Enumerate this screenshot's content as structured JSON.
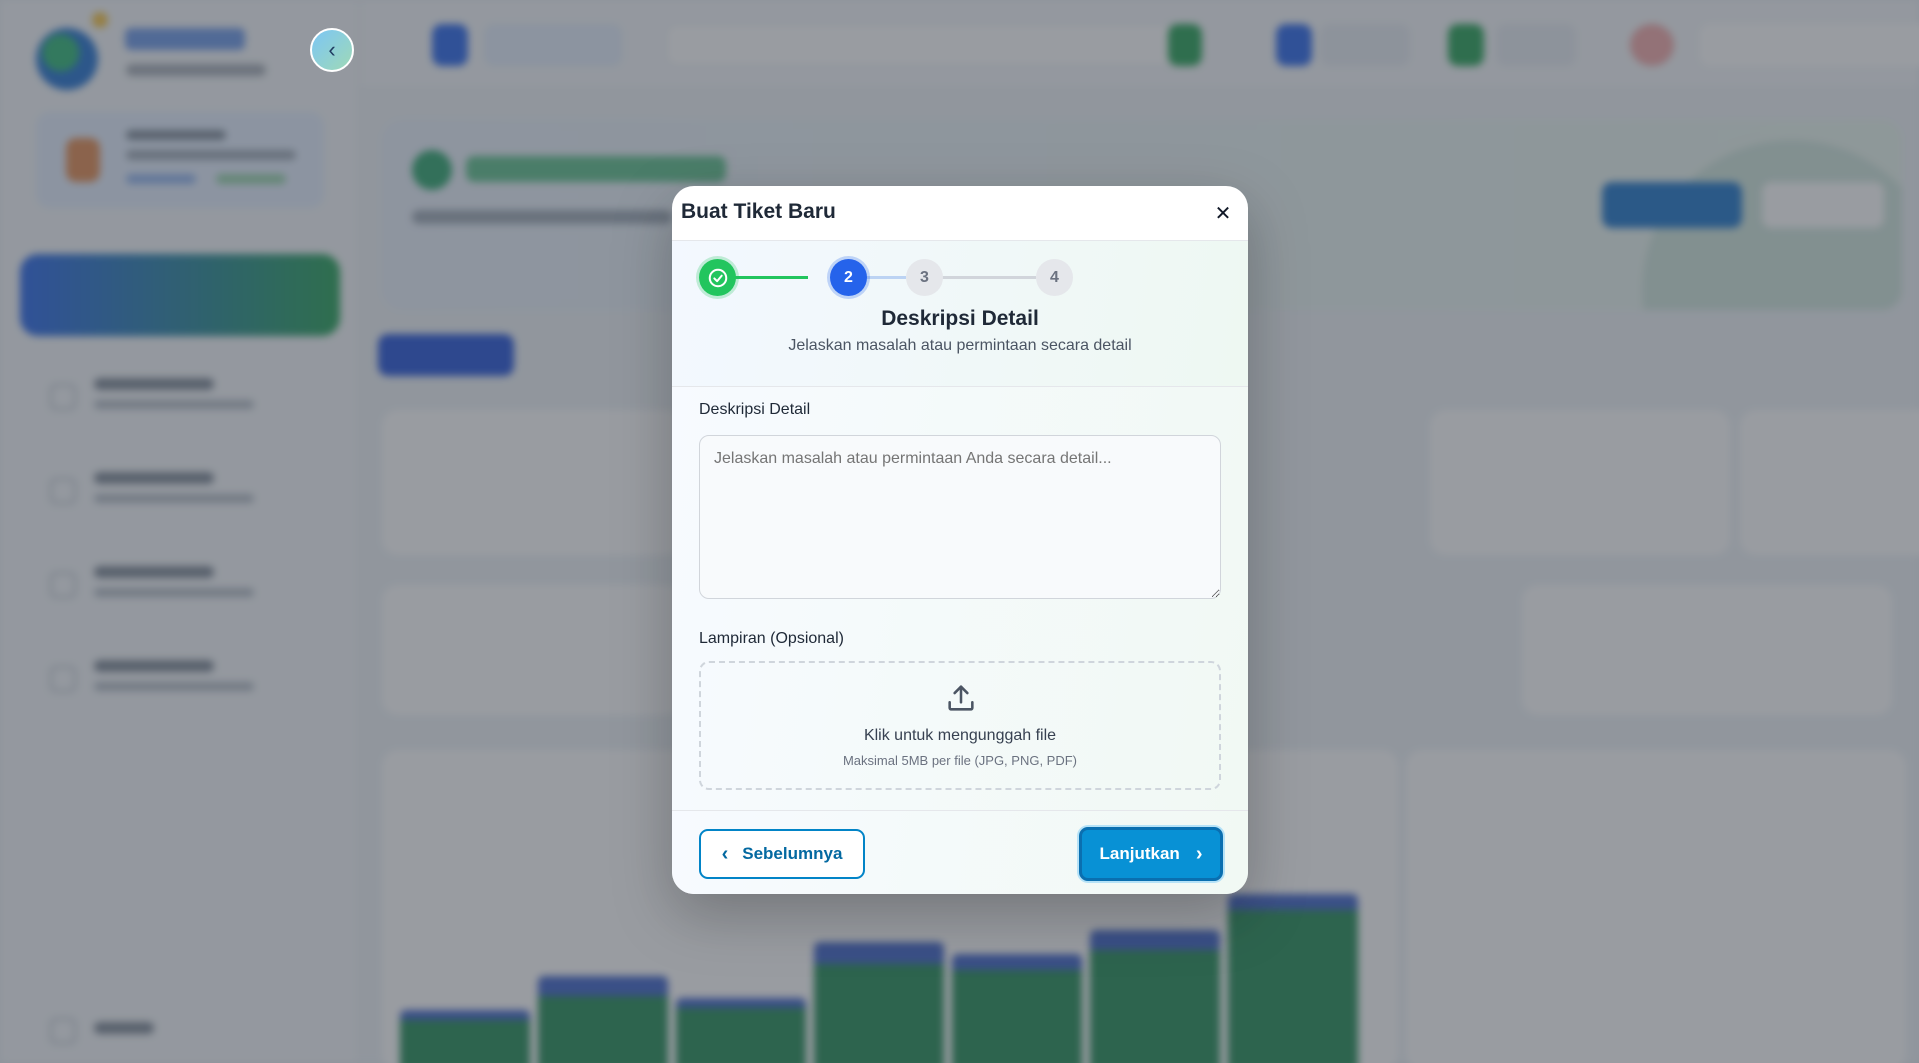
{
  "modal": {
    "title": "Buat Tiket Baru",
    "close_icon": "close-icon",
    "steps": [
      {
        "label": "",
        "state": "done"
      },
      {
        "label": "2",
        "state": "active"
      },
      {
        "label": "3",
        "state": "pending"
      },
      {
        "label": "4",
        "state": "pending"
      }
    ],
    "step_title": "Deskripsi Detail",
    "step_subtitle": "Jelaskan masalah atau permintaan secara detail",
    "description": {
      "label": "Deskripsi Detail",
      "placeholder": "Jelaskan masalah atau permintaan Anda secara detail...",
      "value": ""
    },
    "attachment": {
      "label": "Lampiran (Opsional)",
      "main_text": "Klik untuk mengunggah file",
      "sub_text": "Maksimal 5MB per file (JPG, PNG, PDF)"
    },
    "footer": {
      "prev_label": "Sebelumnya",
      "next_label": "Lanjutkan"
    }
  },
  "colors": {
    "accent": "#2563eb",
    "success": "#22c55e",
    "button": "#0891d5"
  }
}
